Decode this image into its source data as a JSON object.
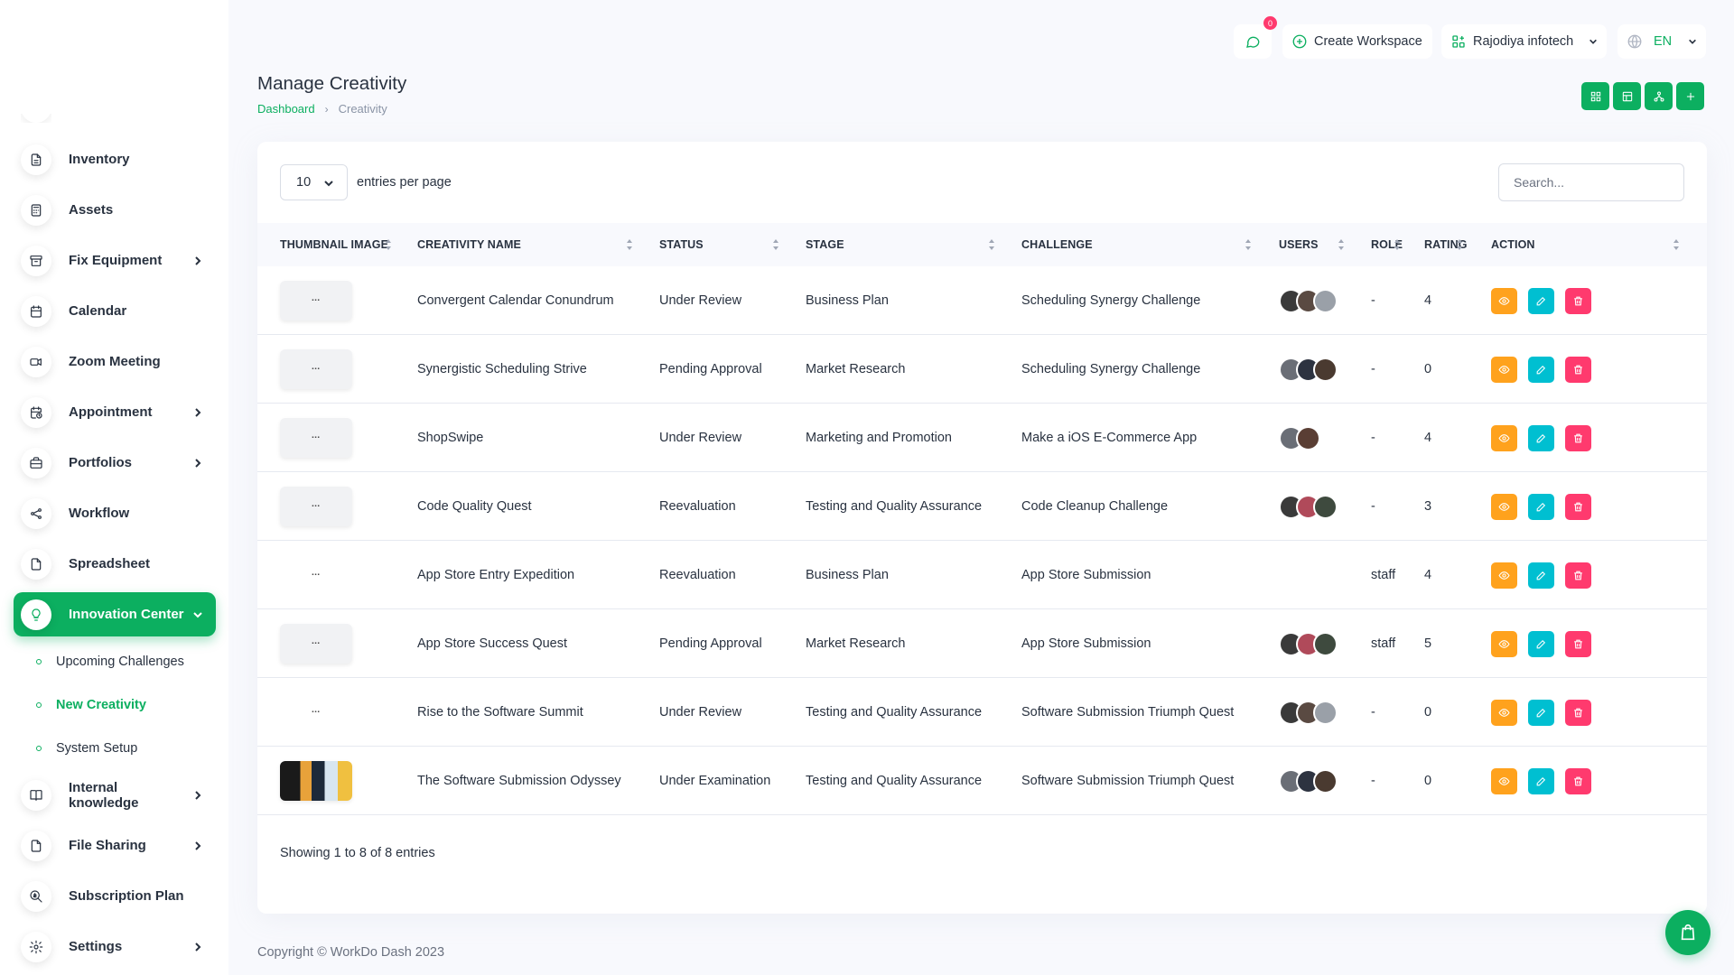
{
  "header": {
    "notification_count": "0",
    "create_workspace": "Create Workspace",
    "workspace_name": "Rajodiya infotech",
    "language": "EN"
  },
  "page": {
    "title": "Manage Creativity",
    "breadcrumb_home": "Dashboard",
    "breadcrumb_current": "Creativity"
  },
  "sidebar": {
    "items": [
      {
        "label": "Inventory",
        "icon": "document-icon"
      },
      {
        "label": "Assets",
        "icon": "calculator-icon"
      },
      {
        "label": "Fix Equipment",
        "icon": "archive-icon"
      },
      {
        "label": "Calendar",
        "icon": "calendar-icon"
      },
      {
        "label": "Zoom Meeting",
        "icon": "video-icon"
      },
      {
        "label": "Appointment",
        "icon": "calendar-clock-icon"
      },
      {
        "label": "Portfolios",
        "icon": "briefcase-icon"
      },
      {
        "label": "Workflow",
        "icon": "share-icon"
      },
      {
        "label": "Spreadsheet",
        "icon": "file-icon"
      },
      {
        "label": "Innovation Center",
        "icon": "bulb-icon"
      },
      {
        "label": "Internal knowledge",
        "icon": "book-icon"
      },
      {
        "label": "File Sharing",
        "icon": "file-icon"
      },
      {
        "label": "Subscription Plan",
        "icon": "zoom-money-icon"
      },
      {
        "label": "Settings",
        "icon": "gear-icon"
      }
    ],
    "sub_items": [
      {
        "label": "Upcoming Challenges"
      },
      {
        "label": "New Creativity"
      },
      {
        "label": "System Setup"
      }
    ]
  },
  "table": {
    "entries_value": "10",
    "entries_label": "entries per page",
    "search_placeholder": "Search...",
    "columns": [
      "THUMBNAIL IMAGE",
      "CREATIVITY NAME",
      "STATUS",
      "STAGE",
      "CHALLENGE",
      "USERS",
      "ROLE",
      "RATING",
      "ACTION"
    ],
    "rows": [
      {
        "thumb": "workdo",
        "name": "Convergent Calendar Conundrum",
        "status": "Under Review",
        "stage": "Business Plan",
        "challenge": "Scheduling Synergy Challenge",
        "users": [
          "#3a3a3a",
          "#5a4a42",
          "#9aa0a8"
        ],
        "role": "-",
        "rating": "4"
      },
      {
        "thumb": "workdo",
        "name": "Synergistic Scheduling Strive",
        "status": "Pending Approval",
        "stage": "Market Research",
        "challenge": "Scheduling Synergy Challenge",
        "users": [
          "#6a6e76",
          "#2d3340",
          "#4a3a30"
        ],
        "role": "-",
        "rating": "0"
      },
      {
        "thumb": "workdo",
        "name": "ShopSwipe",
        "status": "Under Review",
        "stage": "Marketing and Promotion",
        "challenge": "Make a iOS E-Commerce App",
        "users": [
          "#6a6e76",
          "#5a3e34"
        ],
        "role": "-",
        "rating": "4"
      },
      {
        "thumb": "workdo",
        "name": "Code Quality Quest",
        "status": "Reevaluation",
        "stage": "Testing and Quality Assurance",
        "challenge": "Code Cleanup Challenge",
        "users": [
          "#3a3a3a",
          "#b04a5a",
          "#3e4a3e"
        ],
        "role": "-",
        "rating": "3"
      },
      {
        "thumb": "plain",
        "name": "App Store Entry Expedition",
        "status": "Reevaluation",
        "stage": "Business Plan",
        "challenge": "App Store Submission",
        "users": [],
        "role": "staff",
        "rating": "4"
      },
      {
        "thumb": "workdo",
        "name": "App Store Success Quest",
        "status": "Pending Approval",
        "stage": "Market Research",
        "challenge": "App Store Submission",
        "users": [
          "#3a3a3a",
          "#b04a5a",
          "#3e4a3e"
        ],
        "role": "staff",
        "rating": "5"
      },
      {
        "thumb": "plain",
        "name": "Rise to the Software Summit",
        "status": "Under Review",
        "stage": "Testing and Quality Assurance",
        "challenge": "Software Submission Triumph Quest",
        "users": [
          "#3a3a3a",
          "#5a4a42",
          "#9aa0a8"
        ],
        "role": "-",
        "rating": "0"
      },
      {
        "thumb": "photo",
        "name": "The Software Submission Odyssey",
        "status": "Under Examination",
        "stage": "Testing and Quality Assurance",
        "challenge": "Software Submission Triumph Quest",
        "users": [
          "#6a6e76",
          "#2d3340",
          "#4a3a30"
        ],
        "role": "-",
        "rating": "0"
      }
    ],
    "showing": "Showing 1 to 8 of 8 entries"
  },
  "footer": {
    "copyright": "Copyright © WorkDo Dash 2023"
  },
  "colors": {
    "primary": "#0caf60",
    "view": "#ffa21d",
    "edit": "#00bfd1",
    "delete": "#ff3a6e"
  }
}
